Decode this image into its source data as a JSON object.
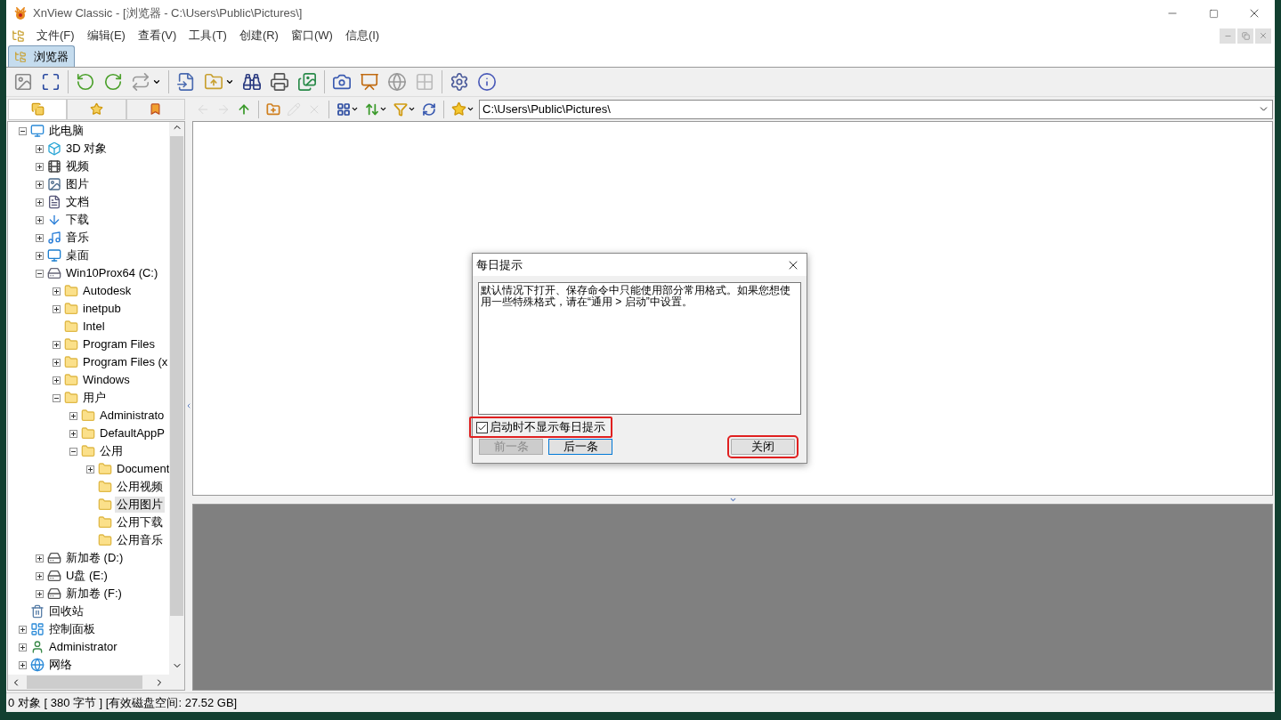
{
  "window": {
    "title": "XnView Classic - [浏览器 - C:\\Users\\Public\\Pictures\\]"
  },
  "menu": [
    "文件(F)",
    "编辑(E)",
    "查看(V)",
    "工具(T)",
    "创建(R)",
    "窗口(W)",
    "信息(I)"
  ],
  "tabs": [
    {
      "label": "浏览器",
      "selected": true
    }
  ],
  "panel_tabs": [
    {
      "selected": true
    },
    {
      "selected": false
    },
    {
      "selected": false
    }
  ],
  "nav_toolbar": [
    {
      "disabled": true
    },
    {
      "disabled": true
    },
    {
      "disabled": false
    },
    {
      "disabled": false
    },
    {
      "disabled": true
    },
    {
      "disabled": true
    },
    {
      "disabled": false
    },
    {
      "disabled": false
    },
    {
      "disabled": false
    },
    {
      "disabled": false
    }
  ],
  "address": {
    "value": "C:\\Users\\Public\\Pictures\\"
  },
  "tree": [
    {
      "label": "此电脑",
      "kind": "pc",
      "expanded": true,
      "selected": false,
      "children": [
        {
          "label": "3D 对象",
          "kind": "cube",
          "expanded": false,
          "selected": false
        },
        {
          "label": "视频",
          "kind": "film",
          "expanded": false,
          "selected": false
        },
        {
          "label": "图片",
          "kind": "image",
          "expanded": false,
          "selected": false
        },
        {
          "label": "文档",
          "kind": "doc",
          "expanded": false,
          "selected": false
        },
        {
          "label": "下载",
          "kind": "download",
          "expanded": false,
          "selected": false
        },
        {
          "label": "音乐",
          "kind": "music",
          "expanded": false,
          "selected": false
        },
        {
          "label": "桌面",
          "kind": "desktop",
          "expanded": false,
          "selected": false
        },
        {
          "label": "Win10Prox64 (C:)",
          "kind": "system-drive",
          "expanded": true,
          "selected": false,
          "children": [
            {
              "label": "Autodesk",
              "kind": "folder",
              "expanded": false,
              "selected": false
            },
            {
              "label": "inetpub",
              "kind": "folder",
              "expanded": false,
              "selected": false
            },
            {
              "label": "Intel",
              "kind": "folder",
              "selected": false
            },
            {
              "label": "Program Files",
              "kind": "folder",
              "expanded": false,
              "selected": false
            },
            {
              "label": "Program Files (x",
              "kind": "folder",
              "expanded": false,
              "selected": false
            },
            {
              "label": "Windows",
              "kind": "folder",
              "expanded": false,
              "selected": false
            },
            {
              "label": "用户",
              "kind": "folder",
              "expanded": true,
              "selected": false,
              "children": [
                {
                  "label": "Administrato",
                  "kind": "folder",
                  "expanded": false,
                  "selected": false
                },
                {
                  "label": "DefaultAppP",
                  "kind": "folder",
                  "expanded": false,
                  "selected": false
                },
                {
                  "label": "公用",
                  "kind": "folder",
                  "expanded": true,
                  "selected": false,
                  "children": [
                    {
                      "label": "Document",
                      "kind": "folder",
                      "expanded": false,
                      "selected": false
                    },
                    {
                      "label": "公用视频",
                      "kind": "folder",
                      "selected": false
                    },
                    {
                      "label": "公用图片",
                      "kind": "folder",
                      "selected": true
                    },
                    {
                      "label": "公用下载",
                      "kind": "folder",
                      "selected": false
                    },
                    {
                      "label": "公用音乐",
                      "kind": "folder",
                      "selected": false
                    }
                  ]
                }
              ]
            }
          ]
        },
        {
          "label": "新加卷 (D:)",
          "kind": "drive",
          "expanded": false,
          "selected": false
        },
        {
          "label": "U盘 (E:)",
          "kind": "drive",
          "expanded": false,
          "selected": false
        },
        {
          "label": "新加卷 (F:)",
          "kind": "drive",
          "expanded": false,
          "selected": false
        }
      ]
    },
    {
      "label": "回收站",
      "kind": "recycle",
      "selected": false
    },
    {
      "label": "控制面板",
      "kind": "control",
      "expanded": false,
      "selected": false
    },
    {
      "label": "Administrator",
      "kind": "user",
      "expanded": false,
      "selected": false
    },
    {
      "label": "网络",
      "kind": "network",
      "expanded": false,
      "selected": false
    }
  ],
  "dialog": {
    "title": "每日提示",
    "text": "默认情况下打开、保存命令中只能使用部分常用格式。如果您想使用一些特殊格式，请在“通用 > 启动”中设置。",
    "checkbox": {
      "label": "启动时不显示每日提示",
      "checked": true,
      "highlighted": true
    },
    "buttons": [
      {
        "label": "前一条",
        "disabled": true,
        "default": false,
        "highlighted": false
      },
      {
        "label": "后一条",
        "disabled": false,
        "default": true,
        "highlighted": false
      },
      {
        "label": "关闭",
        "disabled": false,
        "default": false,
        "highlighted": true
      }
    ]
  },
  "status_bar": "0 对象 [ 380 字节 ] [有效磁盘空间: 27.52 GB]"
}
